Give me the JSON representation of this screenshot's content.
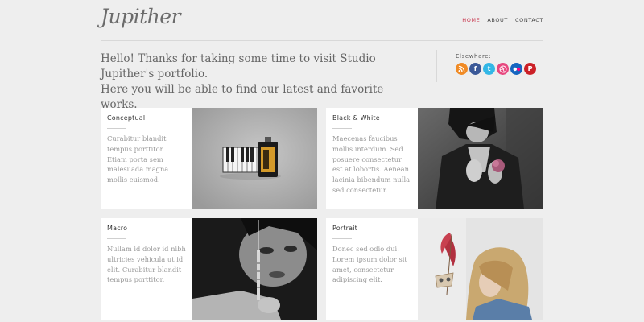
{
  "site": {
    "logo": "Jupither"
  },
  "nav": [
    {
      "label": "HOME",
      "active": true
    },
    {
      "label": "ABOUT",
      "active": false
    },
    {
      "label": "CONTACT",
      "active": false
    }
  ],
  "intro": {
    "line1": "Hello! Thanks for taking some time to visit Studio Jupither's portfolio.",
    "line2": "Here you will be able to find our latest and favorite works."
  },
  "elsewhere": {
    "title": "Elsewhare:",
    "icons": [
      {
        "name": "rss-icon",
        "glyph": "◉",
        "color": "#f08a24"
      },
      {
        "name": "facebook-icon",
        "glyph": "f",
        "color": "#3b5998"
      },
      {
        "name": "twitter-icon",
        "glyph": "t",
        "color": "#33b7e6"
      },
      {
        "name": "dribbble-icon",
        "glyph": "✺",
        "color": "#e7487f"
      },
      {
        "name": "flickr-icon",
        "glyph": "●●",
        "color": "#1565c0"
      },
      {
        "name": "pinterest-icon",
        "glyph": "P",
        "color": "#cb2027"
      }
    ]
  },
  "cards": [
    {
      "title": "Conceptual",
      "desc": "Curabitur blandit tempus porttitor. Etiam porta sem malesuada magna mollis euismod."
    },
    {
      "title": "Black & White",
      "desc": "Maecenas faucibus mollis interdum. Sed posuere consectetur est at lobortis. Aenean lacinia bibendum nulla sed consectetur."
    },
    {
      "title": "Macro",
      "desc": "Nullam id dolor id nibh ultricies vehicula ut id elit. Curabitur blandit tempus porttitor."
    },
    {
      "title": "Portrait",
      "desc": "Donec sed odio dui. Lorem ipsum dolor sit amet, consectetur adipiscing elit."
    }
  ]
}
